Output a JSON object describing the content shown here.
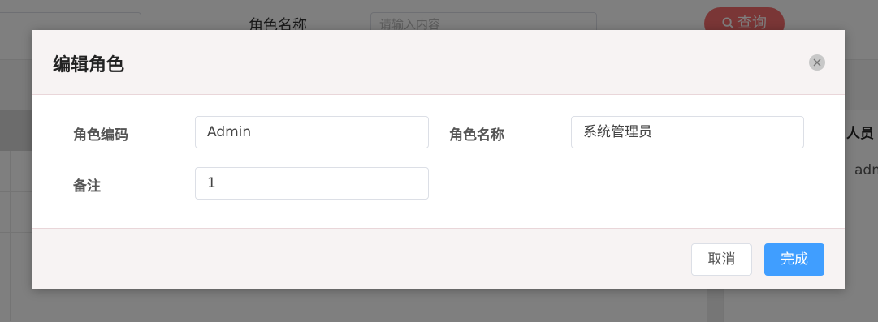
{
  "background": {
    "search_label": "角色名称",
    "search_placeholder": "请输入内容",
    "query_button_label": "查询",
    "right_column_header": "人员",
    "right_column_cell": "adm"
  },
  "dialog": {
    "title": "编辑角色",
    "fields": {
      "role_code": {
        "label": "角色编码",
        "value": "Admin"
      },
      "role_name": {
        "label": "角色名称",
        "value": "系统管理员"
      },
      "remark": {
        "label": "备注",
        "value": "1"
      }
    },
    "cancel_label": "取消",
    "confirm_label": "完成"
  },
  "colors": {
    "primary": "#409eff",
    "danger": "#f56c6c",
    "dialog_header_bg": "#f7f3f3"
  },
  "icons": {
    "close": "close-icon",
    "search": "search-icon"
  }
}
